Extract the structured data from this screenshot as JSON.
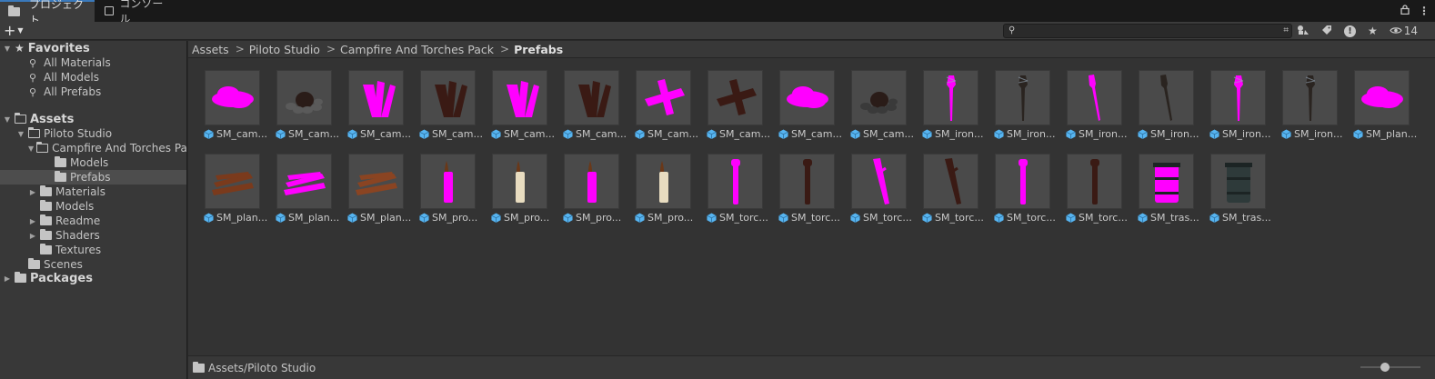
{
  "tabs": [
    {
      "label": "プロジェクト",
      "icon": "folder-icon",
      "active": true
    },
    {
      "label": "コンソール",
      "icon": "console-icon",
      "active": false
    }
  ],
  "toolbar": {
    "add_label": "+",
    "search_value": "",
    "hidden_count": "14"
  },
  "sidebar": {
    "favorites": {
      "label": "Favorites",
      "items": [
        "All Materials",
        "All Models",
        "All Prefabs"
      ]
    },
    "assets": {
      "label": "Assets",
      "tree": {
        "piloto": "Piloto Studio",
        "campfire": "Campfire And Torches Pack",
        "models_inner": "Models",
        "prefabs": "Prefabs",
        "materials": "Materials",
        "models": "Models",
        "readme": "Readme",
        "shaders": "Shaders",
        "textures": "Textures",
        "scenes": "Scenes"
      }
    },
    "packages": {
      "label": "Packages"
    }
  },
  "breadcrumb": [
    "Assets",
    "Piloto Studio",
    "Campfire And Torches Pack",
    "Prefabs"
  ],
  "assets": [
    {
      "label": "SM_cam...",
      "kind": "pile",
      "color": "#ff00ff"
    },
    {
      "label": "SM_cam...",
      "kind": "stones",
      "color": "#5a5a5a"
    },
    {
      "label": "SM_cam...",
      "kind": "bundle",
      "color": "#ff00ff"
    },
    {
      "label": "SM_cam...",
      "kind": "bundle",
      "color": "#3a1a14"
    },
    {
      "label": "SM_cam...",
      "kind": "bundle",
      "color": "#ff00ff"
    },
    {
      "label": "SM_cam...",
      "kind": "bundle",
      "color": "#3a1a14"
    },
    {
      "label": "SM_cam...",
      "kind": "cross",
      "color": "#ff00ff"
    },
    {
      "label": "SM_cam...",
      "kind": "cross",
      "color": "#3a1a14"
    },
    {
      "label": "SM_cam...",
      "kind": "pile",
      "color": "#ff00ff"
    },
    {
      "label": "SM_cam...",
      "kind": "stones",
      "color": "#3a3a3a"
    },
    {
      "label": "SM_iron...",
      "kind": "torch",
      "color": "#ff00ff"
    },
    {
      "label": "SM_iron...",
      "kind": "torch",
      "color": "#2a2420"
    },
    {
      "label": "SM_iron...",
      "kind": "torchtilt",
      "color": "#ff00ff"
    },
    {
      "label": "SM_iron...",
      "kind": "torchtilt",
      "color": "#2a2420"
    },
    {
      "label": "SM_iron...",
      "kind": "torch",
      "color": "#ff00ff"
    },
    {
      "label": "SM_iron...",
      "kind": "torch",
      "color": "#2a2420"
    },
    {
      "label": "SM_plan...",
      "kind": "pile",
      "color": "#ff00ff"
    },
    {
      "label": "SM_plan...",
      "kind": "planks",
      "color": "#7a3a1c"
    },
    {
      "label": "SM_plan...",
      "kind": "planks",
      "color": "#ff00ff"
    },
    {
      "label": "SM_plan...",
      "kind": "planks",
      "color": "#8a4422"
    },
    {
      "label": "SM_pro...",
      "kind": "candle",
      "color": "#ff00ff"
    },
    {
      "label": "SM_pro...",
      "kind": "candle",
      "color": "#e8dcc0"
    },
    {
      "label": "SM_pro...",
      "kind": "candle",
      "color": "#ff00ff"
    },
    {
      "label": "SM_pro...",
      "kind": "candle",
      "color": "#e8dcc0"
    },
    {
      "label": "SM_torc...",
      "kind": "stick",
      "color": "#ff00ff"
    },
    {
      "label": "SM_torc...",
      "kind": "stick",
      "color": "#3a1a14"
    },
    {
      "label": "SM_torc...",
      "kind": "sticktilt",
      "color": "#ff00ff"
    },
    {
      "label": "SM_torc...",
      "kind": "sticktilt",
      "color": "#3a1a14"
    },
    {
      "label": "SM_torc...",
      "kind": "stick",
      "color": "#ff00ff"
    },
    {
      "label": "SM_torc...",
      "kind": "stick",
      "color": "#3a1a14"
    },
    {
      "label": "SM_tras...",
      "kind": "bin",
      "color": "#ff00ff"
    },
    {
      "label": "SM_tras...",
      "kind": "bin",
      "color": "#2e3a3a"
    }
  ],
  "status_path": "Assets/Piloto Studio",
  "zoom_level": 0.4,
  "colors": {
    "accent": "#3a79bb",
    "missing_material": "#ff00ff",
    "asset_cube": "#56b4f0"
  }
}
